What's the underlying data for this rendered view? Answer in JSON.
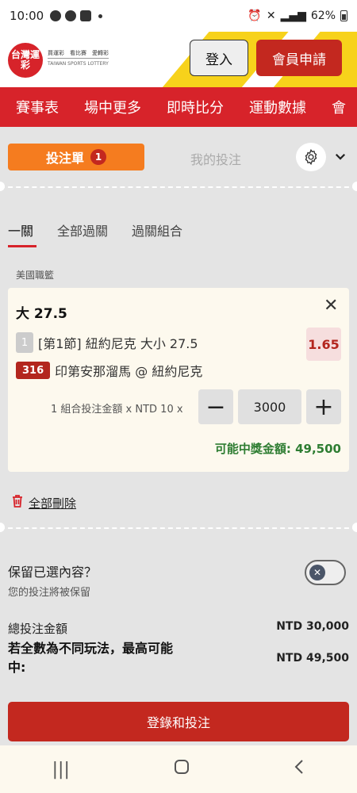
{
  "status_bar": {
    "time": "10:00",
    "battery": "62%"
  },
  "header": {
    "logo_text": "台灣運彩",
    "logo_tagline": "買運彩　看比賽　愛轉彩",
    "logo_sub": "TAIWAN SPORTS LOTTERY",
    "login_label": "登入",
    "register_label": "會員申請"
  },
  "nav": {
    "items": [
      "賽事表",
      "場中更多",
      "即時比分",
      "運動數據",
      "會"
    ]
  },
  "betslip": {
    "tab_label": "投注單",
    "badge_count": "1",
    "my_bets_label": "我的投注",
    "subtabs": [
      "一關",
      "全部過關",
      "過關組合"
    ],
    "league": "美國職籃",
    "bet": {
      "title": "大 27.5",
      "period_num": "1",
      "description": "[第1節] 紐約尼克 大小 27.5",
      "odds": "1.65",
      "match_code": "316",
      "match_name": "印第安那溜馬 @ 紐約尼克",
      "stake_label": "1 組合投注金額 x NTD 10 x",
      "stake_value": "3000",
      "potential_win_label": "可能中獎金額:",
      "potential_win_value": "49,500"
    },
    "delete_all_label": "全部刪除",
    "keep_question": "保留已選內容？",
    "keep_sub": "您的投注將被保留",
    "total_label": "總投注金額",
    "total_value": "NTD 30,000",
    "max_win_label": "若全數為不同玩法，最高可能中:",
    "max_win_value": "NTD 49,500",
    "submit_label": "登錄和投注"
  },
  "colors": {
    "brand_red": "#d7232a",
    "accent_orange": "#f57c1f",
    "win_green": "#2e7d32"
  }
}
